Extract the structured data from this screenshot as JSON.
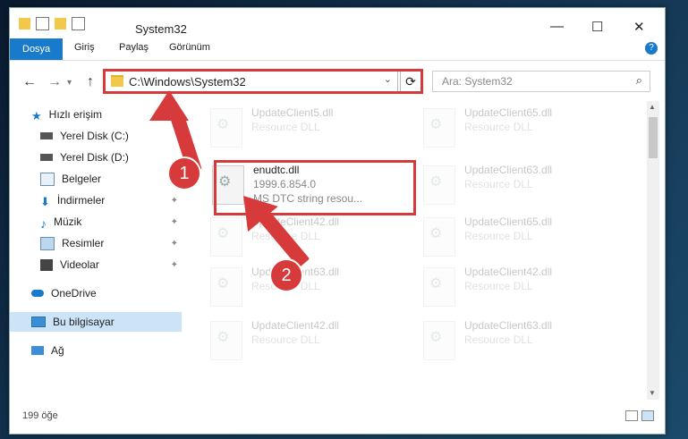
{
  "window": {
    "title": "System32",
    "minimize": "—",
    "maximize": "☐",
    "close": "✕"
  },
  "ribbon": {
    "tabs": [
      "Dosya",
      "Giriş",
      "Paylaş",
      "Görünüm"
    ],
    "help": "?"
  },
  "nav": {
    "back": "←",
    "forward": "→",
    "up": "↑",
    "address": "C:\\Windows\\System32",
    "refresh": "⟳",
    "search_placeholder": "Ara: System32"
  },
  "sidebar": {
    "quick_access": "Hızlı erişim",
    "items": [
      "Yerel Disk (C:)",
      "Yerel Disk (D:)",
      "Belgeler",
      "İndirmeler",
      "Müzik",
      "Resimler",
      "Videolar"
    ],
    "onedrive": "OneDrive",
    "this_pc": "Bu bilgisayar",
    "network": "Ağ"
  },
  "files": [
    {
      "name": "UpdateClient5.dll",
      "type": "Resource DLL"
    },
    {
      "name": "UpdateClient65.dll",
      "type": "Resource DLL"
    },
    {
      "name": "enudtc.dll",
      "version": "1999.6.854.0",
      "description": "MS DTC string resou..."
    },
    {
      "name": "UpdateClient63.dll",
      "type": "Resource DLL"
    },
    {
      "name": "UpdateClient42.dll",
      "type": "Resource DLL"
    },
    {
      "name": "UpdateClient65.dll",
      "type": "Resource DLL"
    },
    {
      "name": "UpdateClient63.dll",
      "type": "Resource DLL"
    },
    {
      "name": "UpdateClient42.dll",
      "type": "Resource DLL"
    },
    {
      "name": "UpdateClient42.dll",
      "type": "Resource DLL"
    },
    {
      "name": "UpdateClient63.dll",
      "type": "Resource DLL"
    }
  ],
  "status": {
    "count": "199 öğe"
  },
  "annotations": {
    "step1": "1",
    "step2": "2",
    "color": "#d63a3a"
  }
}
